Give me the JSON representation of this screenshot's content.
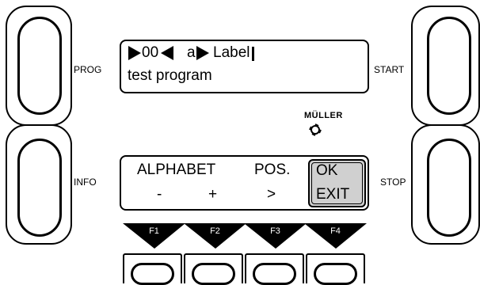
{
  "side_buttons": {
    "prog_label": "PROG",
    "info_label": "INFO",
    "start_label": "START",
    "stop_label": "STOP"
  },
  "top_display": {
    "line1_index": "00",
    "line1_char": "a",
    "line1_text": "Label",
    "line2_text": "test program"
  },
  "bottom_display": {
    "menu_alphabet": "ALPHABET",
    "menu_pos": "POS.",
    "menu_ok": "OK",
    "menu_minus": "-",
    "menu_plus": "+",
    "menu_greater": ">",
    "menu_exit": "EXIT"
  },
  "brand": {
    "logo_text": "MÜLLER"
  },
  "function_keys": [
    {
      "label": "F1"
    },
    {
      "label": "F2"
    },
    {
      "label": "F3"
    },
    {
      "label": "F4"
    }
  ],
  "colors": {
    "ok_highlight": "#d0d0d0",
    "key_fill": "#000000"
  }
}
